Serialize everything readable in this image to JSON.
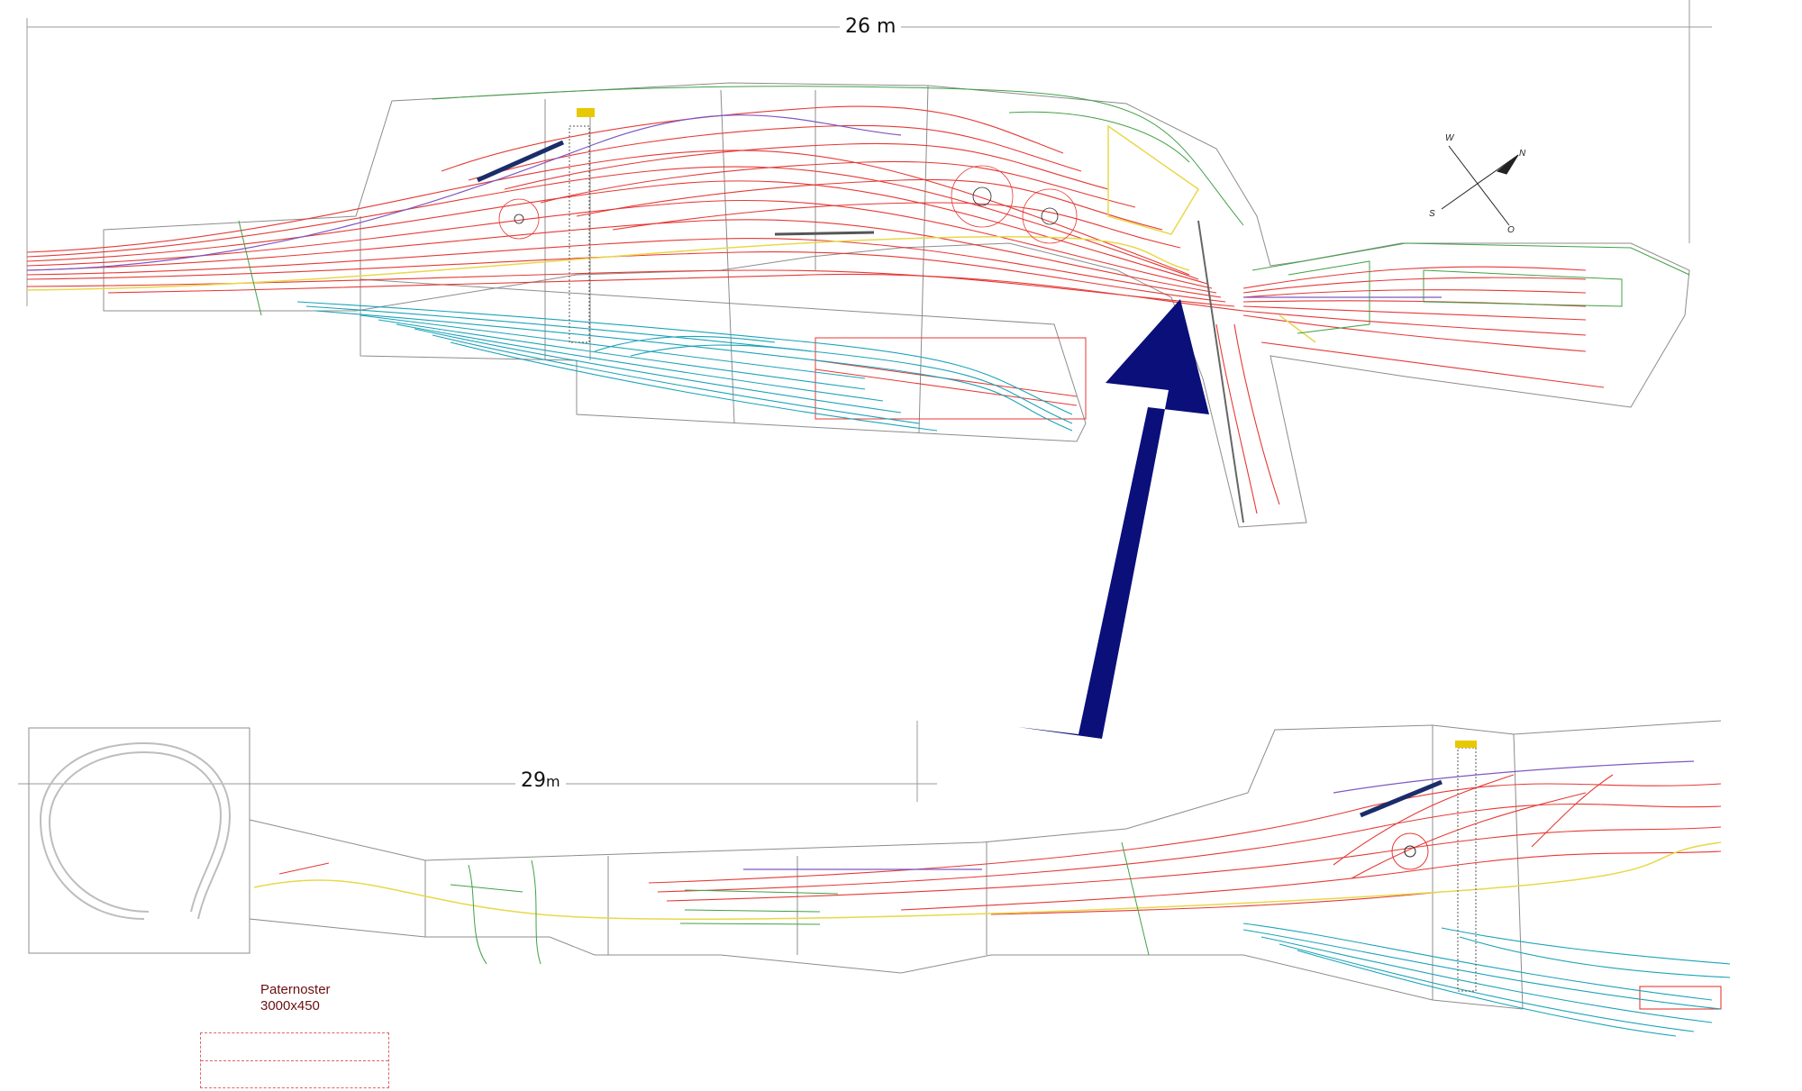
{
  "dimensions": {
    "top_width": "26 m",
    "bottom_width_number": "29",
    "bottom_width_unit": "m"
  },
  "compass": {
    "west": "W",
    "north": "N",
    "south": "S",
    "east": "O"
  },
  "paternoster": {
    "title": "Paternoster",
    "size": "3000x450"
  },
  "colors": {
    "track_red": "#e53935",
    "track_blue": "#1aa3b8",
    "track_yellow": "#e8d84a",
    "track_green": "#43a047",
    "track_purple": "#7e57c2",
    "outline_gray": "#8a8a8a",
    "arrow_navy": "#0a0f7a"
  },
  "icons": [
    "turntable-icon",
    "compass-icon",
    "direction-arrow-icon"
  ]
}
